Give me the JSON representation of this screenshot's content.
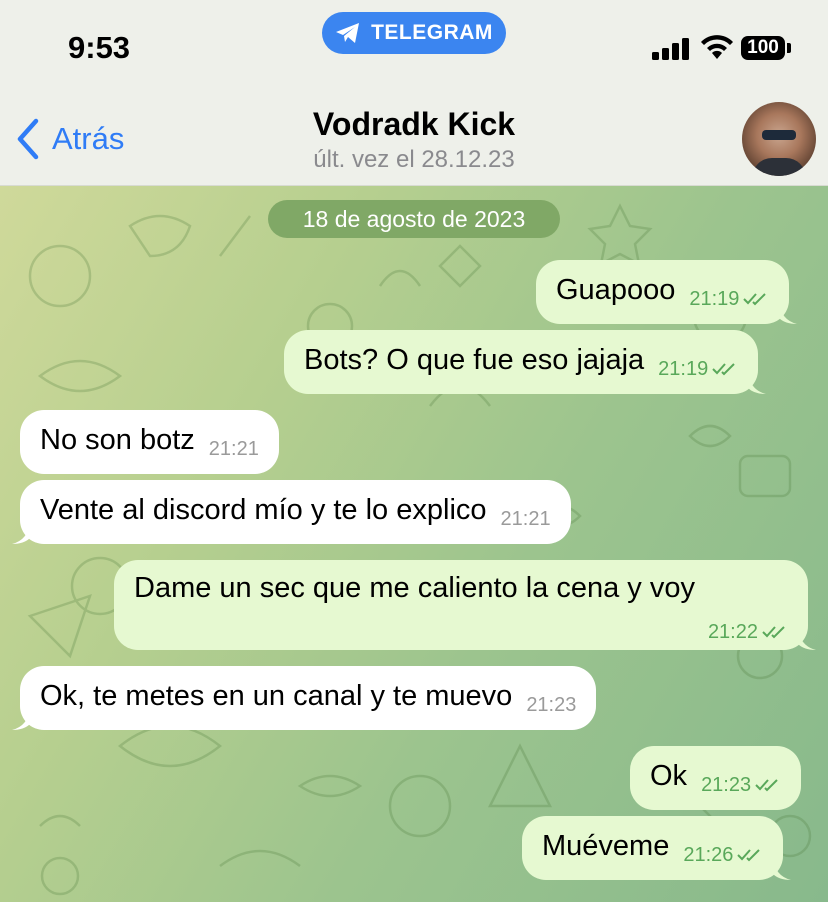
{
  "status_bar": {
    "time": "9:53",
    "app_pill": "TELEGRAM",
    "battery": "100"
  },
  "header": {
    "back_label": "Atrás",
    "contact_name": "Vodradk Kick",
    "last_seen": "últ. vez el 28.12.23"
  },
  "chat": {
    "date_separator": "18 de agosto de 2023",
    "messages": [
      {
        "direction": "out",
        "text": "Guapooo",
        "time": "21:19",
        "read": true
      },
      {
        "direction": "out",
        "text": "Bots? O que fue eso jajaja",
        "time": "21:19",
        "read": true
      },
      {
        "direction": "in",
        "text": "No son botz",
        "time": "21:21"
      },
      {
        "direction": "in",
        "text": "Vente al discord mío y te lo explico",
        "time": "21:21"
      },
      {
        "direction": "out",
        "text": "Dame un sec que me caliento la cena y voy",
        "time": "21:22",
        "read": true
      },
      {
        "direction": "in",
        "text": "Ok, te metes en un canal y te muevo",
        "time": "21:23"
      },
      {
        "direction": "out",
        "text": "Ok",
        "time": "21:23",
        "read": true
      },
      {
        "direction": "out",
        "text": "Muéveme",
        "time": "21:26",
        "read": true
      }
    ]
  },
  "colors": {
    "accent": "#2f7cf6",
    "outgoing_bubble": "#e6f9d1",
    "incoming_bubble": "#ffffff",
    "read_check": "#59a85a",
    "telegram_pill": "#3b85f0"
  }
}
